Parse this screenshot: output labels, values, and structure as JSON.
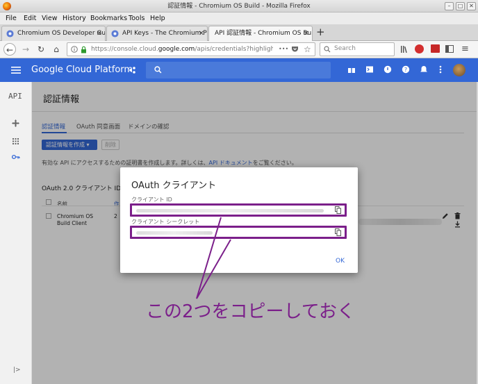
{
  "window": {
    "title": "認証情報 - Chromium OS Build - Mozilla Firefox",
    "btn_min": "–",
    "btn_max": "□",
    "btn_close": "✕"
  },
  "menu": [
    "File",
    "Edit",
    "View",
    "History",
    "Bookmarks",
    "Tools",
    "Help"
  ],
  "tabs": [
    {
      "label": "Chromium OS Developer Guid"
    },
    {
      "label": "API Keys - The Chromium Pro"
    },
    {
      "label": "API 認証情報 - Chromium OS Buil"
    }
  ],
  "tab_close": "✕",
  "new_tab": "+",
  "nav": {
    "url_host_prefix": "https://console.cloud.",
    "url_host": "google.com",
    "url_path": "/apis/credentials?highlightClie",
    "url_more": "•••",
    "search_placeholder": "Search",
    "back": "←",
    "forward": "→",
    "reload": "↻",
    "home": "⌂"
  },
  "gcp": {
    "title": "Google Cloud Platform"
  },
  "leftnav": {
    "api_label": "API",
    "expand": "|>"
  },
  "page": {
    "title": "認証情報",
    "subtabs": [
      "認証情報",
      "OAuth 同意画面",
      "ドメインの確認"
    ],
    "create_button": "認証情報を作成 ▾",
    "delete_button": "削除",
    "description_before": "有効な API にアクセスするための証明書を作成します。詳しくは、",
    "description_link": "API ドキュメント",
    "description_after": "をご覧ください。",
    "oauth_heading": "OAuth 2.0 クライアント ID",
    "col_name": "名前",
    "col_created": "作",
    "row_name": "Chromium OS\nBuild Client",
    "row_created": "2"
  },
  "dialog": {
    "title": "OAuth クライアント",
    "client_id_label": "クライアント ID",
    "client_secret_label": "クライアント シークレット",
    "ok": "OK"
  },
  "annotation": "この2つをコピーしておく",
  "colors": {
    "gcp_blue": "#3367d6",
    "annotation": "#7b1f8a"
  }
}
